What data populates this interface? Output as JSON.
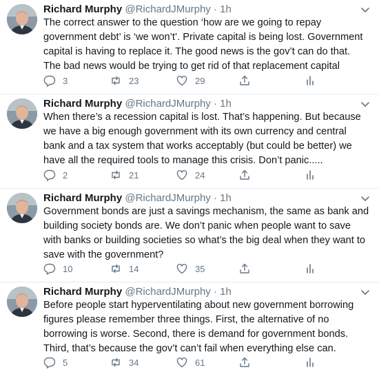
{
  "tweets": [
    {
      "name": "Richard Murphy",
      "handle": "@RichardJMurphy",
      "dot": "·",
      "time": "1h",
      "text": "The correct answer to the question ‘how are we going to repay\ngovernment debt’ is ‘we won’t’. Private capital is being lost. Government\ncapital is having to replace it. The good news is the gov’t can do that.\nThe bad news would be trying to get rid of that replacement capital",
      "replies": "3",
      "retweets": "23",
      "likes": "29"
    },
    {
      "name": "Richard Murphy",
      "handle": "@RichardJMurphy",
      "dot": "·",
      "time": "1h",
      "text": "When there’s a recession capital is lost. That’s happening. But because\nwe have a big enough government with its own currency and central\nbank and a tax system that works acceptably (but could be better) we\nhave all the required tools to manage this crisis. Don’t panic.....",
      "replies": "2",
      "retweets": "21",
      "likes": "24"
    },
    {
      "name": "Richard Murphy",
      "handle": "@RichardJMurphy",
      "dot": "·",
      "time": "1h",
      "text": "Government bonds are just a savings mechanism, the same as bank and\nbuilding society bonds are. We don’t panic when people want to save\nwith banks or building societies so what’s the big deal when they want to\nsave with the government?",
      "replies": "10",
      "retweets": "14",
      "likes": "35"
    },
    {
      "name": "Richard Murphy",
      "handle": "@RichardJMurphy",
      "dot": "·",
      "time": "1h",
      "text": "Before people start hyperventilating about new government borrowing\nfigures please remember three things. First, the alternative of no\nborrowing is worse. Second, there is demand for government bonds.\nThird, that’s because the gov’t can’t fail when everything else can.",
      "replies": "5",
      "retweets": "34",
      "likes": "61"
    }
  ],
  "colors": {
    "text": "#14171a",
    "secondary": "#657786",
    "divider": "#e6ecf0"
  },
  "icons": [
    "chevron-down-icon",
    "reply-icon",
    "retweet-icon",
    "like-icon",
    "share-icon",
    "analytics-icon"
  ]
}
